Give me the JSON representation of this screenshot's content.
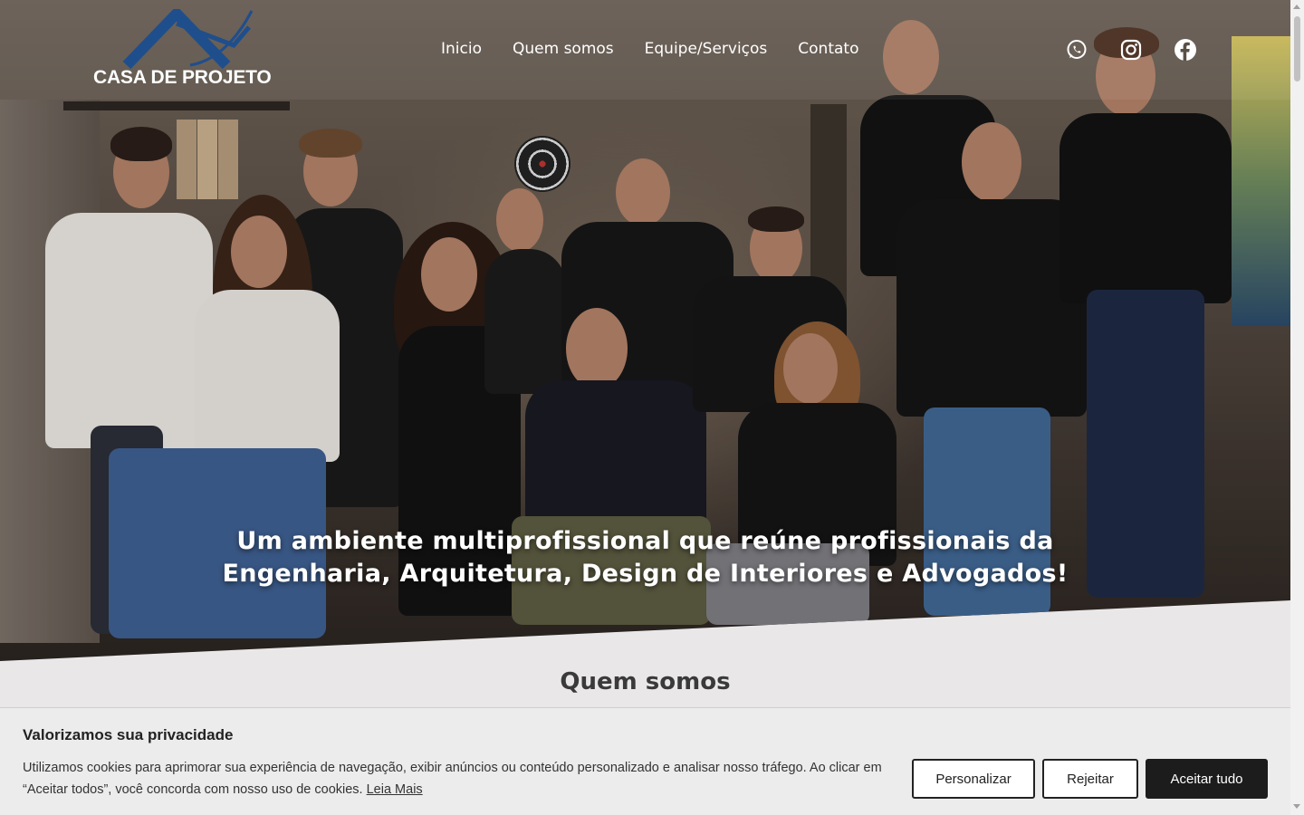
{
  "brand": {
    "name": "CASA DE PROJETO"
  },
  "nav": {
    "items": [
      {
        "label": "Inicio"
      },
      {
        "label": "Quem somos"
      },
      {
        "label": "Equipe/Serviços"
      },
      {
        "label": "Contato"
      }
    ]
  },
  "social": {
    "icons": [
      "whatsapp-icon",
      "instagram-icon",
      "facebook-icon"
    ]
  },
  "hero": {
    "line1": "Um ambiente multiprofissional que reúne profissionais da",
    "line2": "Engenharia, Arquitetura, Design de Interiores e Advogados!"
  },
  "about": {
    "title": "Quem somos"
  },
  "cookie": {
    "title": "Valorizamos sua privacidade",
    "text": "Utilizamos cookies para aprimorar sua experiência de navegação, exibir anúncios ou conteúdo personalizado e analisar nosso tráfego. Ao clicar em “Aceitar todos”, você concorda com nosso uso de cookies.",
    "link": "Leia Mais",
    "customize": "Personalizar",
    "reject": "Rejeitar",
    "accept": "Aceitar tudo"
  },
  "colors": {
    "accent_dark": "#1c1c1c",
    "logo_blue": "#1f4e8c",
    "banner_bg": "#ececec"
  }
}
